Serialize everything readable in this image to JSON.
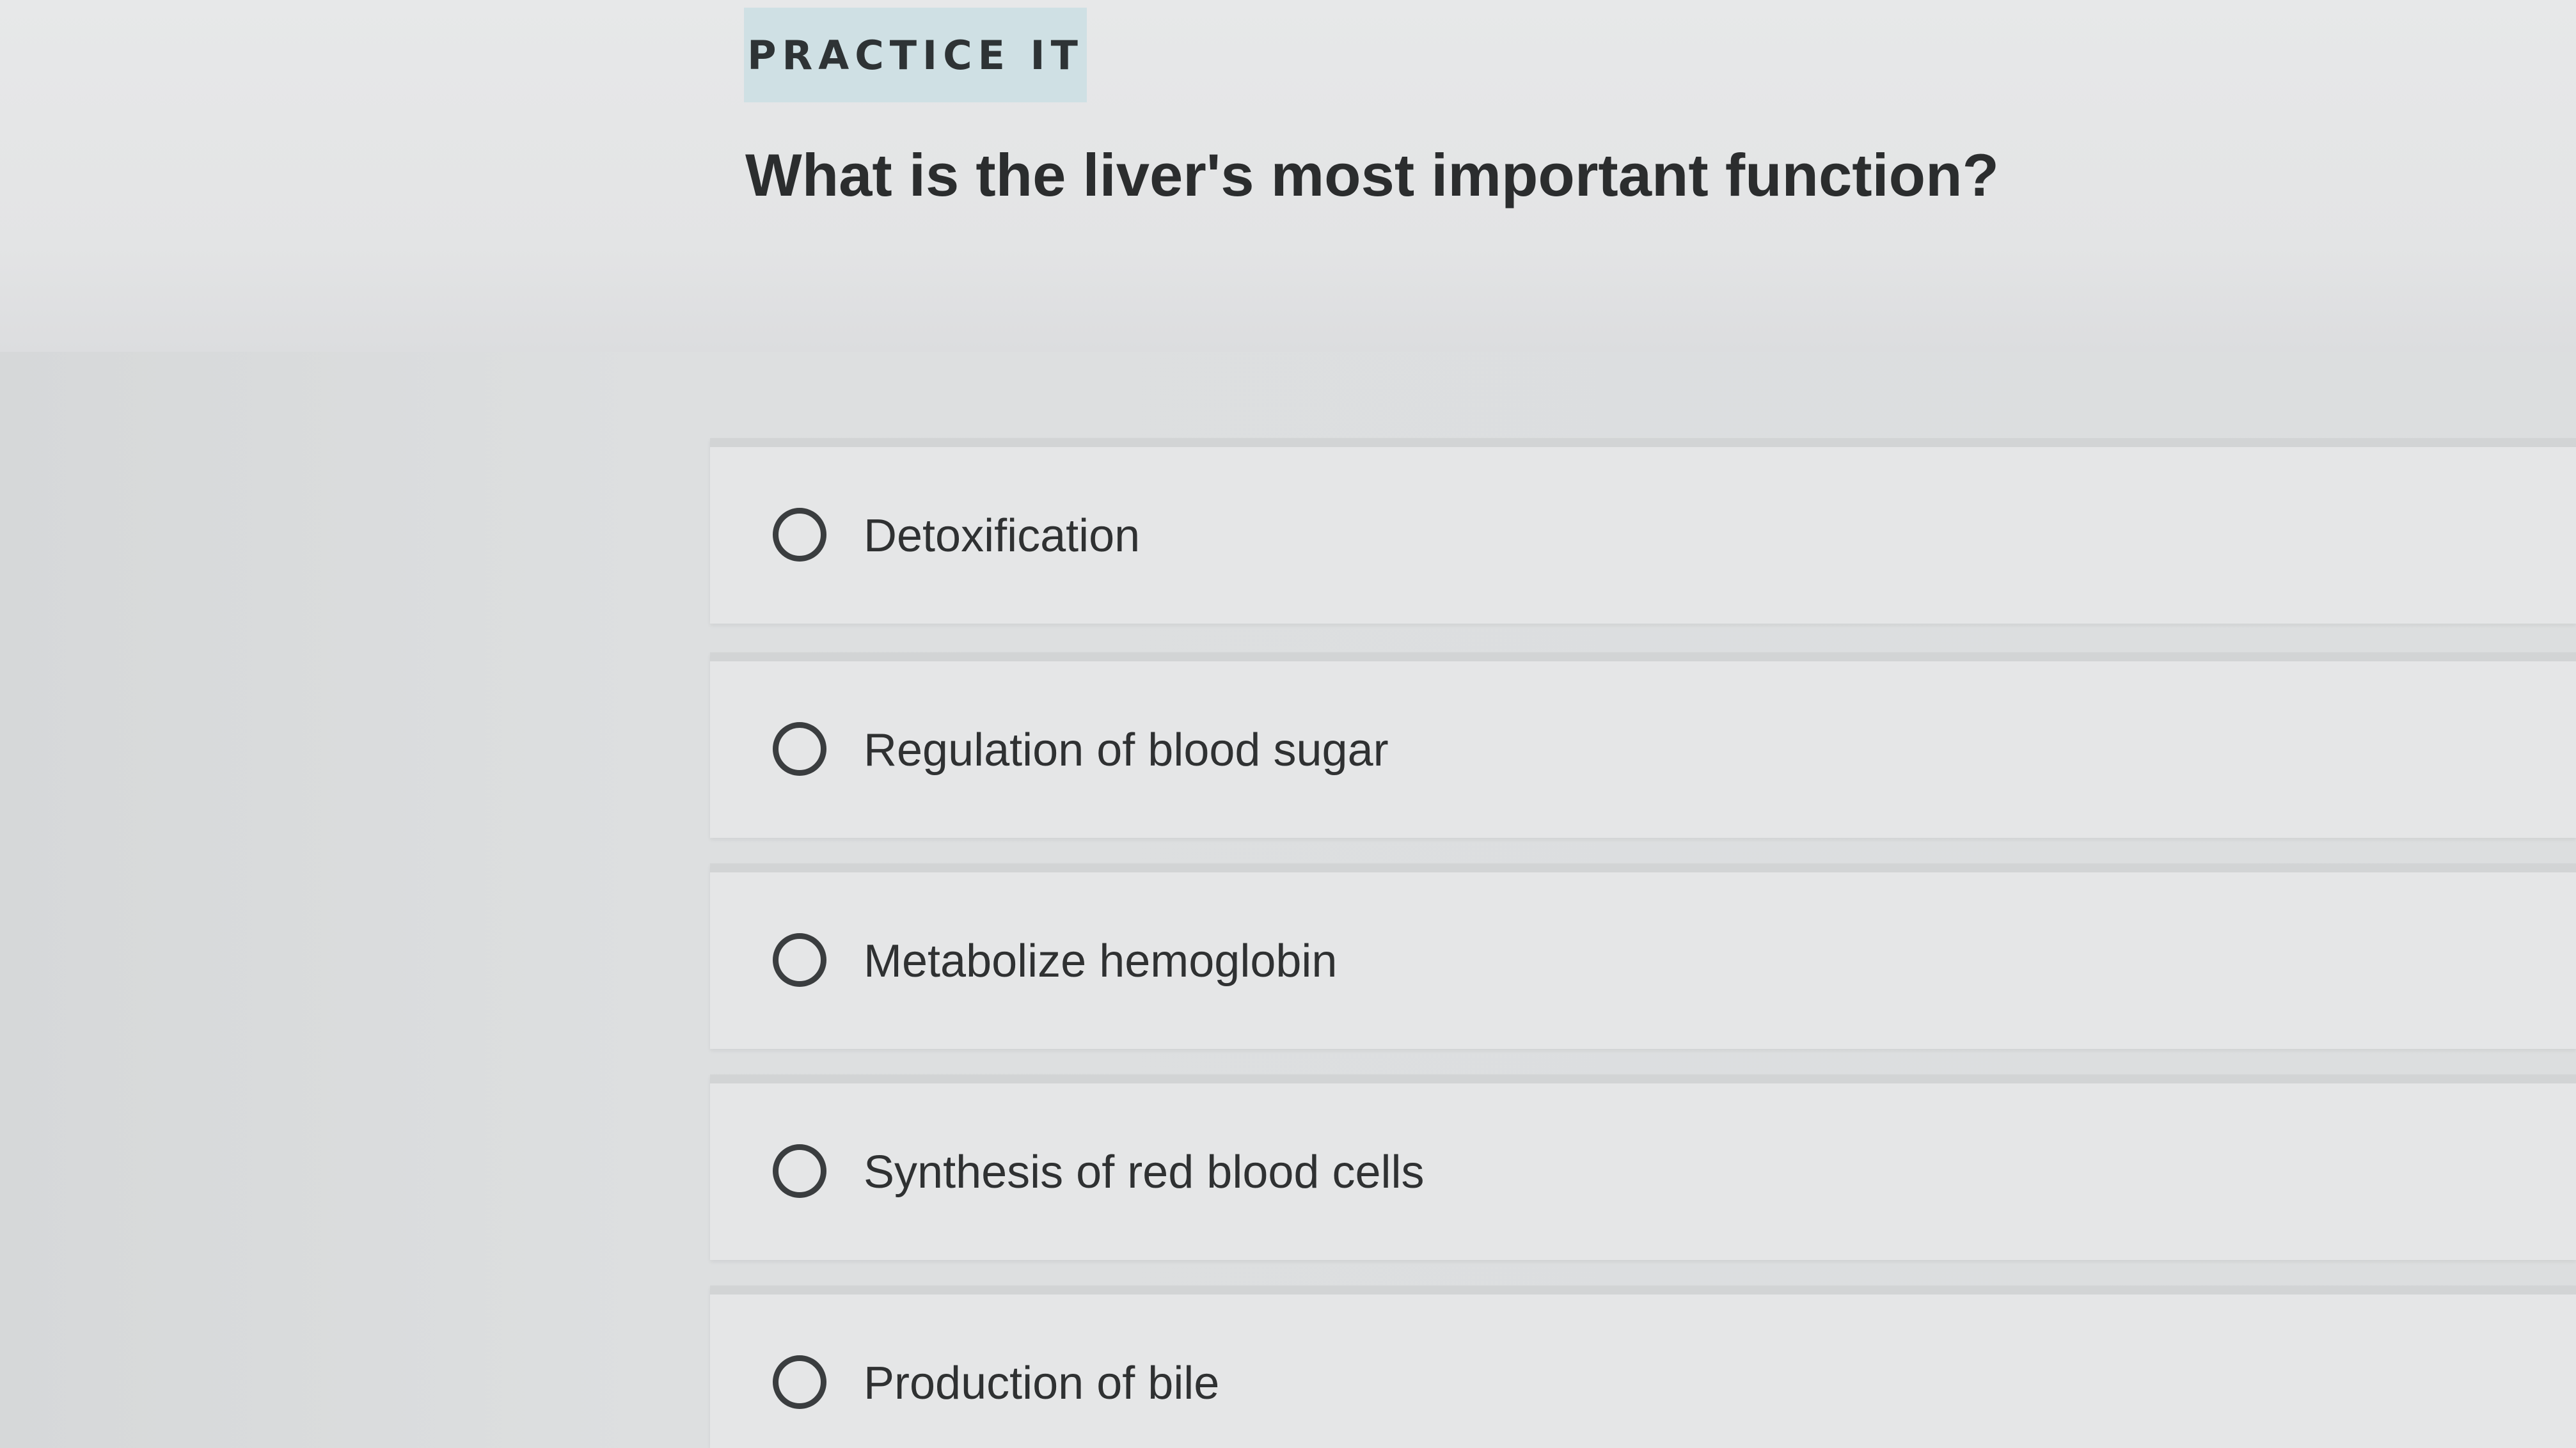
{
  "badge": {
    "label": "PRACTICE IT"
  },
  "question": {
    "text": "What is the liver's most important function?"
  },
  "choices": [
    {
      "label": "Detoxification",
      "selected": false
    },
    {
      "label": "Regulation of blood sugar",
      "selected": false
    },
    {
      "label": "Metabolize hemoglobin",
      "selected": false
    },
    {
      "label": "Synthesis of red blood cells",
      "selected": false
    },
    {
      "label": "Production of bile",
      "selected": false
    }
  ],
  "colors": {
    "badge_background": "#cfe0e4",
    "page_background": "#e3e4e5",
    "text": "#2b2d2e"
  }
}
